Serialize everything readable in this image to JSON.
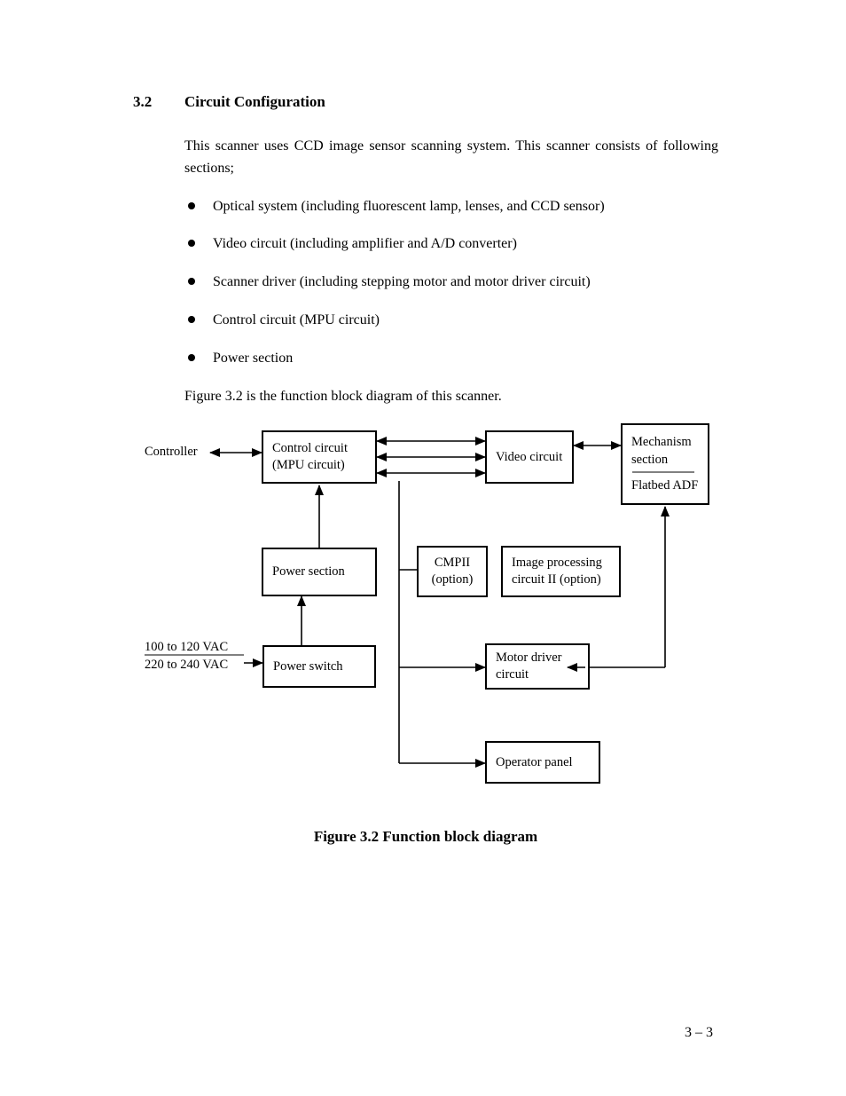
{
  "heading": {
    "number": "3.2",
    "title": "Circuit Configuration"
  },
  "intro": "This scanner uses CCD image sensor scanning system.  This scanner consists of following sections;",
  "bullets": [
    "Optical system (including fluorescent lamp, lenses, and CCD sensor)",
    "Video circuit (including amplifier and A/D converter)",
    "Scanner driver (including stepping motor and motor driver circuit)",
    "Control circuit (MPU circuit)",
    "Power section"
  ],
  "fig_ref": "Figure 3.2 is the function block diagram of this scanner.",
  "diagram": {
    "controller": "Controller",
    "control_circuit_l1": "Control circuit",
    "control_circuit_l2": "(MPU circuit)",
    "video_circuit": "Video circuit",
    "mechanism_l1": "Mechanism",
    "mechanism_l2": "section",
    "mechanism_l3": "Flatbed ADF",
    "power_section": "Power section",
    "cmpii_l1": "CMPII",
    "cmpii_l2": "(option)",
    "ipc_l1": "Image processing",
    "ipc_l2": "circuit II  (option)",
    "vac_l1": "100 to 120 VAC",
    "vac_l2": "220 to 240 VAC",
    "power_switch": "Power switch",
    "motor_driver_l1": "Motor driver",
    "motor_driver_l2": "circuit",
    "operator_panel": "Operator panel"
  },
  "caption": "Figure 3.2   Function block diagram",
  "page_number": "3 – 3"
}
